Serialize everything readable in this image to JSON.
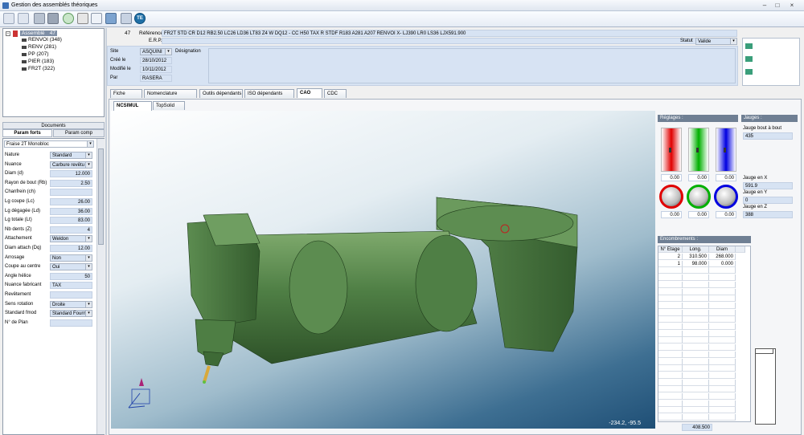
{
  "window": {
    "title": "Gestion des assemblés théoriques",
    "controls": [
      "–",
      "□",
      "×"
    ]
  },
  "toolbar": {
    "icons": [
      "menu-dropdown-icon",
      "menu-dropdown-icon",
      "save-icon",
      "disk-icon",
      "refresh-icon",
      "search-icon",
      "preview-icon",
      "print-icon",
      "te-logo-icon"
    ]
  },
  "tree": {
    "root": "Assemblé",
    "root_count": "47",
    "items": [
      {
        "label": "RENVOI (348)"
      },
      {
        "label": "RENV (281)"
      },
      {
        "label": "PP (207)"
      },
      {
        "label": "PIER (183)"
      },
      {
        "label": "FR2T (322)"
      }
    ]
  },
  "left_tabs": {
    "documents": "Documents",
    "param_forts": "Param forts",
    "param_comp": "Param comp"
  },
  "params": {
    "tool_type": "Fraise 2T Monobloc",
    "rows": [
      {
        "label": "Nature",
        "value": "Standard",
        "kind": "select"
      },
      {
        "label": "Nuance",
        "value": "Carbure revêtu",
        "kind": "select"
      },
      {
        "label": "Diam (d)",
        "value": "12.000",
        "kind": "num"
      },
      {
        "label": "Rayon de bout (Rb)",
        "value": "2.50",
        "kind": "num"
      },
      {
        "label": "Chanfrein (ch)",
        "value": "",
        "kind": "num"
      },
      {
        "label": "Lg coupe (Lc)",
        "value": "26.00",
        "kind": "num"
      },
      {
        "label": "Lg dégagée (Ld)",
        "value": "36.00",
        "kind": "num"
      },
      {
        "label": "Lg totale (Lt)",
        "value": "83.00",
        "kind": "num"
      },
      {
        "label": "Nb dents (Z)",
        "value": "4",
        "kind": "num"
      },
      {
        "label": "Attachement",
        "value": "Weldon",
        "kind": "select"
      },
      {
        "label": "Diam attach (Dq)",
        "value": "12.00",
        "kind": "num"
      },
      {
        "label": "Arrosage",
        "value": "Non",
        "kind": "select"
      },
      {
        "label": "Coupe au centre",
        "value": "Oui",
        "kind": "select"
      },
      {
        "label": "Angle hélice",
        "value": "50",
        "kind": "num"
      },
      {
        "label": "Nuance fabricant",
        "value": "TAX",
        "kind": "text"
      },
      {
        "label": "Revêtement",
        "value": "",
        "kind": "text"
      },
      {
        "label": "Sens rotation",
        "value": "Droite",
        "kind": "select"
      },
      {
        "label": "Standard fmod",
        "value": "Standard Fournis",
        "kind": "select"
      },
      {
        "label": "N° de Plan",
        "value": "",
        "kind": "text"
      }
    ]
  },
  "header": {
    "id": "47",
    "reference_label": "Référence",
    "reference": "FR2T STD CR D12 RB2.50 LC26 LD36 LT83 Z4 W DQ12 - CC H50 TAX R STDF R183 A281 A207 RENVOI X- LJ390 LR0 LS36 LJX591.900",
    "erp_label": "E.R.P.",
    "statut_label": "Statut",
    "statut": "Valide",
    "site_label": "Site",
    "site": "ASQUINI",
    "designation_label": "Désignation",
    "cree_label": "Créé le",
    "cree": "28/10/2012",
    "modifie_label": "Modifié le",
    "modifie": "10/11/2012",
    "par_label": "Par",
    "par": "RASERA"
  },
  "main_tabs": [
    "Fiche",
    "Nomenclature",
    "Outils dépendants",
    "ISO dépendants",
    "CAO",
    "CDC"
  ],
  "sub_tabs": [
    "NCSIMUL",
    "TopSolid"
  ],
  "viewport": {
    "coords": "-234.2, -95.5"
  },
  "reglages": {
    "title": "Réglages :",
    "slider_values": [
      "0.00",
      "0.00",
      "0.00"
    ],
    "knob_values": [
      "0.00",
      "0.00",
      "0.00"
    ],
    "slider_colors": [
      "#e00000",
      "#00b000",
      "#0000e0"
    ]
  },
  "jauges": {
    "title": "Jauges :",
    "bout_label": "Jauge bout à bout",
    "bout_value": "435",
    "x_label": "Jauge en X",
    "x_value": "591.9",
    "y_label": "Jauge en Y",
    "y_value": "0",
    "z_label": "Jauge en Z",
    "z_value": "388"
  },
  "encombrements": {
    "title": "Encombrements :",
    "columns": [
      "N° Etage",
      "Long.",
      "Diam"
    ],
    "rows": [
      {
        "etage": "2",
        "long": "310.500",
        "diam": "268.000"
      },
      {
        "etage": "1",
        "long": "98.000",
        "diam": "0.000"
      }
    ],
    "total": "408.500"
  }
}
